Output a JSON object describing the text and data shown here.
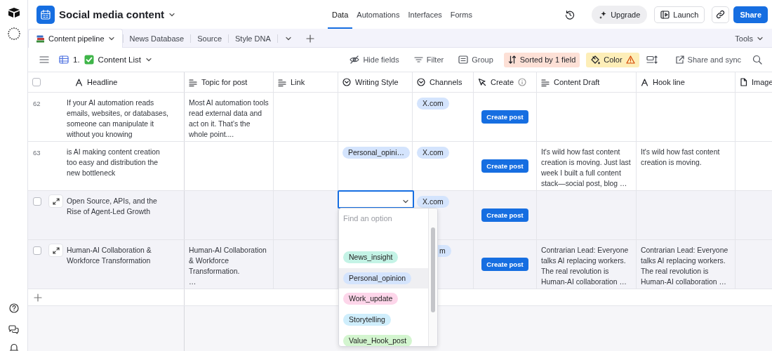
{
  "base": {
    "title": "Social media content"
  },
  "nav": [
    {
      "label": "Data",
      "selected": true
    },
    {
      "label": "Automations",
      "selected": false
    },
    {
      "label": "Interfaces",
      "selected": false
    },
    {
      "label": "Forms",
      "selected": false
    }
  ],
  "actions": {
    "upgrade": "Upgrade",
    "launch": "Launch",
    "share": "Share"
  },
  "tables": [
    {
      "label": "Content pipeline",
      "selected": true
    },
    {
      "label": "News Database",
      "selected": false
    },
    {
      "label": "Source",
      "selected": false
    },
    {
      "label": "Style DNA",
      "selected": false
    }
  ],
  "tools": "Tools",
  "view": {
    "number": "1.",
    "name": "Content List"
  },
  "toolbar": [
    {
      "kind": "hide",
      "label": "Hide fields",
      "active": false
    },
    {
      "kind": "filter",
      "label": "Filter",
      "active": false
    },
    {
      "kind": "group",
      "label": "Group",
      "active": false
    },
    {
      "kind": "sort",
      "label": "Sorted by 1 field",
      "active": true
    },
    {
      "kind": "color",
      "label": "Color",
      "active": true,
      "warning": true
    },
    {
      "kind": "row_height"
    },
    {
      "kind": "share_sync",
      "label": "Share and sync",
      "active": false
    },
    {
      "kind": "search"
    }
  ],
  "header_checkbox": {
    "checked": false
  },
  "columns": [
    {
      "kind": "text",
      "label": "Headline"
    },
    {
      "kind": "long_text",
      "label": "Topic for post"
    },
    {
      "kind": "long_text",
      "label": "Link"
    },
    {
      "kind": "select",
      "label": "Writing Style"
    },
    {
      "kind": "select",
      "label": "Channels"
    },
    {
      "kind": "button",
      "label": "Create",
      "info": true
    },
    {
      "kind": "long_text",
      "label": "Content Draft"
    },
    {
      "kind": "text",
      "label": "Hook line"
    },
    {
      "kind": "attachment",
      "label": "Image"
    }
  ],
  "rows": [
    {
      "number": "62",
      "highlighted": false,
      "headline": "If your AI automation reads emails, websites, or databases, someone can manipulate it without you knowing",
      "topic": "Most AI automation tools read external data and act on it. That’s the whole point....",
      "channels": [
        {
          "label": "X.com",
          "color": "#d4e4fd",
          "covered": false
        }
      ],
      "create": "Create post"
    },
    {
      "number": "63",
      "highlighted": false,
      "headline": "is AI making content creation too easy and distribution the new bottleneck",
      "writing_style": {
        "label": "Personal_opini…",
        "color": "#d4e4fd"
      },
      "channels": [
        {
          "label": "X.com",
          "color": "#d4e4fd",
          "covered": false
        }
      ],
      "create": "Create post",
      "content_draft": "It's wild how fast content creation is moving. Just last week I built a full content stack—social post, blog …",
      "hook_line": "It's wild how fast content creation is moving."
    },
    {
      "checked": false,
      "highlighted": true,
      "editing": true,
      "headline": "Open Source, APIs, and the Rise of Agent-Led Growth",
      "channels": [
        {
          "label": "X.com",
          "color": "#d4e4fd",
          "covered": false
        }
      ],
      "create": "Create post"
    },
    {
      "checked": false,
      "highlighted": true,
      "headline": "Human-AI Collaboration & Workforce Transformation",
      "topic": "Human-AI Collaboration & Workforce Transformation.\n…",
      "channels": [
        {
          "label": "m",
          "color": "#d4e4fd",
          "covered": true
        }
      ],
      "create": "Create post",
      "content_draft": "Contrarian Lead: Everyone talks AI replacing workers. The real revolution is Human-AI collaboration …",
      "hook_line": "Contrarian Lead: Everyone talks AI replacing workers. The real revolution is Human-AI collaboration …"
    }
  ],
  "dropdown": {
    "placeholder": "Find an option",
    "options": [
      {
        "label": "News_insight",
        "color": "#c4f3e6",
        "highlighted": false
      },
      {
        "label": "Personal_opinion",
        "color": "#d4e4fd",
        "highlighted": true
      },
      {
        "label": "Work_update",
        "color": "#fdd6ea",
        "highlighted": false
      },
      {
        "label": "Storytelling",
        "color": "#cfeefc",
        "highlighted": false
      },
      {
        "label": "Value_Hook_post",
        "color": "#d3f5cf",
        "highlighted": false
      }
    ]
  }
}
